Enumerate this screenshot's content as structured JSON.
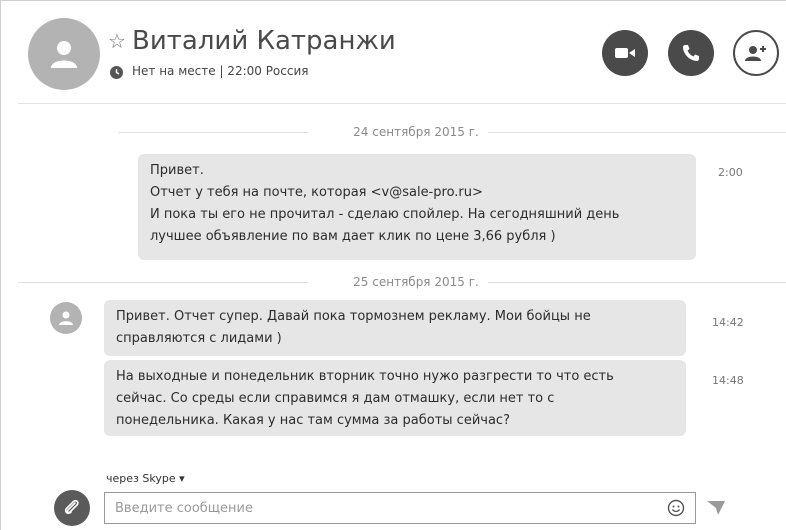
{
  "header": {
    "contact_name": "Виталий Катранжи",
    "status": "Нет на месте | 22:00 Россия",
    "star_glyph": "☆"
  },
  "conversation": {
    "dates": [
      "24 сентября 2015 г.",
      "25 сентября 2015 г."
    ],
    "messages": [
      {
        "lines": [
          "Привет.",
          "Отчет у тебя на почте, которая <v@sale-pro.ru>",
          "И пока ты его не прочитал - сделаю спойлер. На сегодняшний день",
          "лучшее объявление по вам дает клик по цене 3,66 рубля )"
        ],
        "time": "2:00"
      },
      {
        "lines": [
          "Привет. Отчет супер. Давай пока тормознем рекламу. Мои бойцы не",
          "справляются с лидами )"
        ],
        "time": "14:42"
      },
      {
        "lines": [
          "На выходные и понедельник вторник точно нужо разгрести то что есть",
          "сейчас. Со среды если справимся я дам отмашку, если нет то с",
          "понедельника.  Какая у нас там сумма за работы сейчас?"
        ],
        "time": "14:48"
      }
    ]
  },
  "composer": {
    "via_label": "через Skype ▾",
    "placeholder": "Введите сообщение"
  },
  "colors": {
    "bubble": "#e6e6e6",
    "header_button": "#4a4a4a",
    "avatar": "#b3b3b3"
  },
  "icons": [
    "user-icon",
    "clock-icon",
    "video-icon",
    "phone-icon",
    "add-contact-icon",
    "paperclip-icon",
    "emoji-icon",
    "send-icon"
  ]
}
